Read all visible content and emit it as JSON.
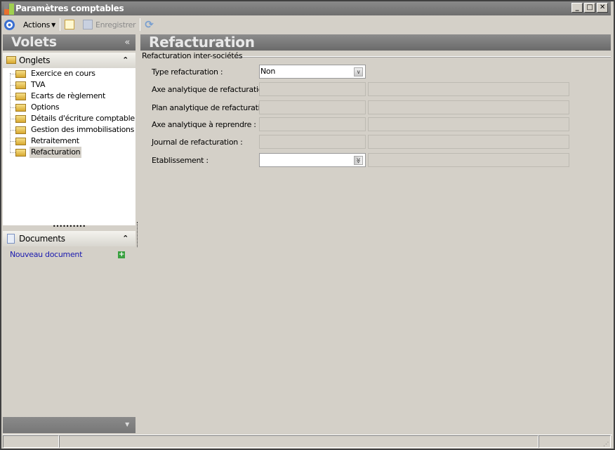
{
  "window": {
    "title": "Paramètres comptables",
    "minimize": "_",
    "maximize": "□",
    "close": "✕"
  },
  "toolbar": {
    "actions": "Actions",
    "save": "Enregistrer"
  },
  "left": {
    "title": "Volets",
    "collapse": "«",
    "tabs_section": {
      "title": "Onglets",
      "items": [
        "Exercice en cours",
        "TVA",
        "Ecarts de règlement",
        "Options",
        "Détails d'écriture comptable",
        "Gestion des immobilisations",
        "Retraitement",
        "Refacturation"
      ],
      "selected": "Refacturation"
    },
    "documents_section": {
      "title": "Documents",
      "new_document": "Nouveau document"
    }
  },
  "main": {
    "title": "Refacturation",
    "group": "Refacturation inter-sociétés",
    "fields": [
      {
        "label": "Type refacturation :",
        "value": "Non"
      },
      {
        "label": "Axe analytique de refacturation :",
        "value": ""
      },
      {
        "label": "Plan analytique de refacturation",
        "value": ""
      },
      {
        "label": "Axe analytique à reprendre :",
        "value": ""
      },
      {
        "label": "Journal de refacturation :",
        "value": ""
      },
      {
        "label": "Etablissement :",
        "value": ""
      }
    ]
  }
}
